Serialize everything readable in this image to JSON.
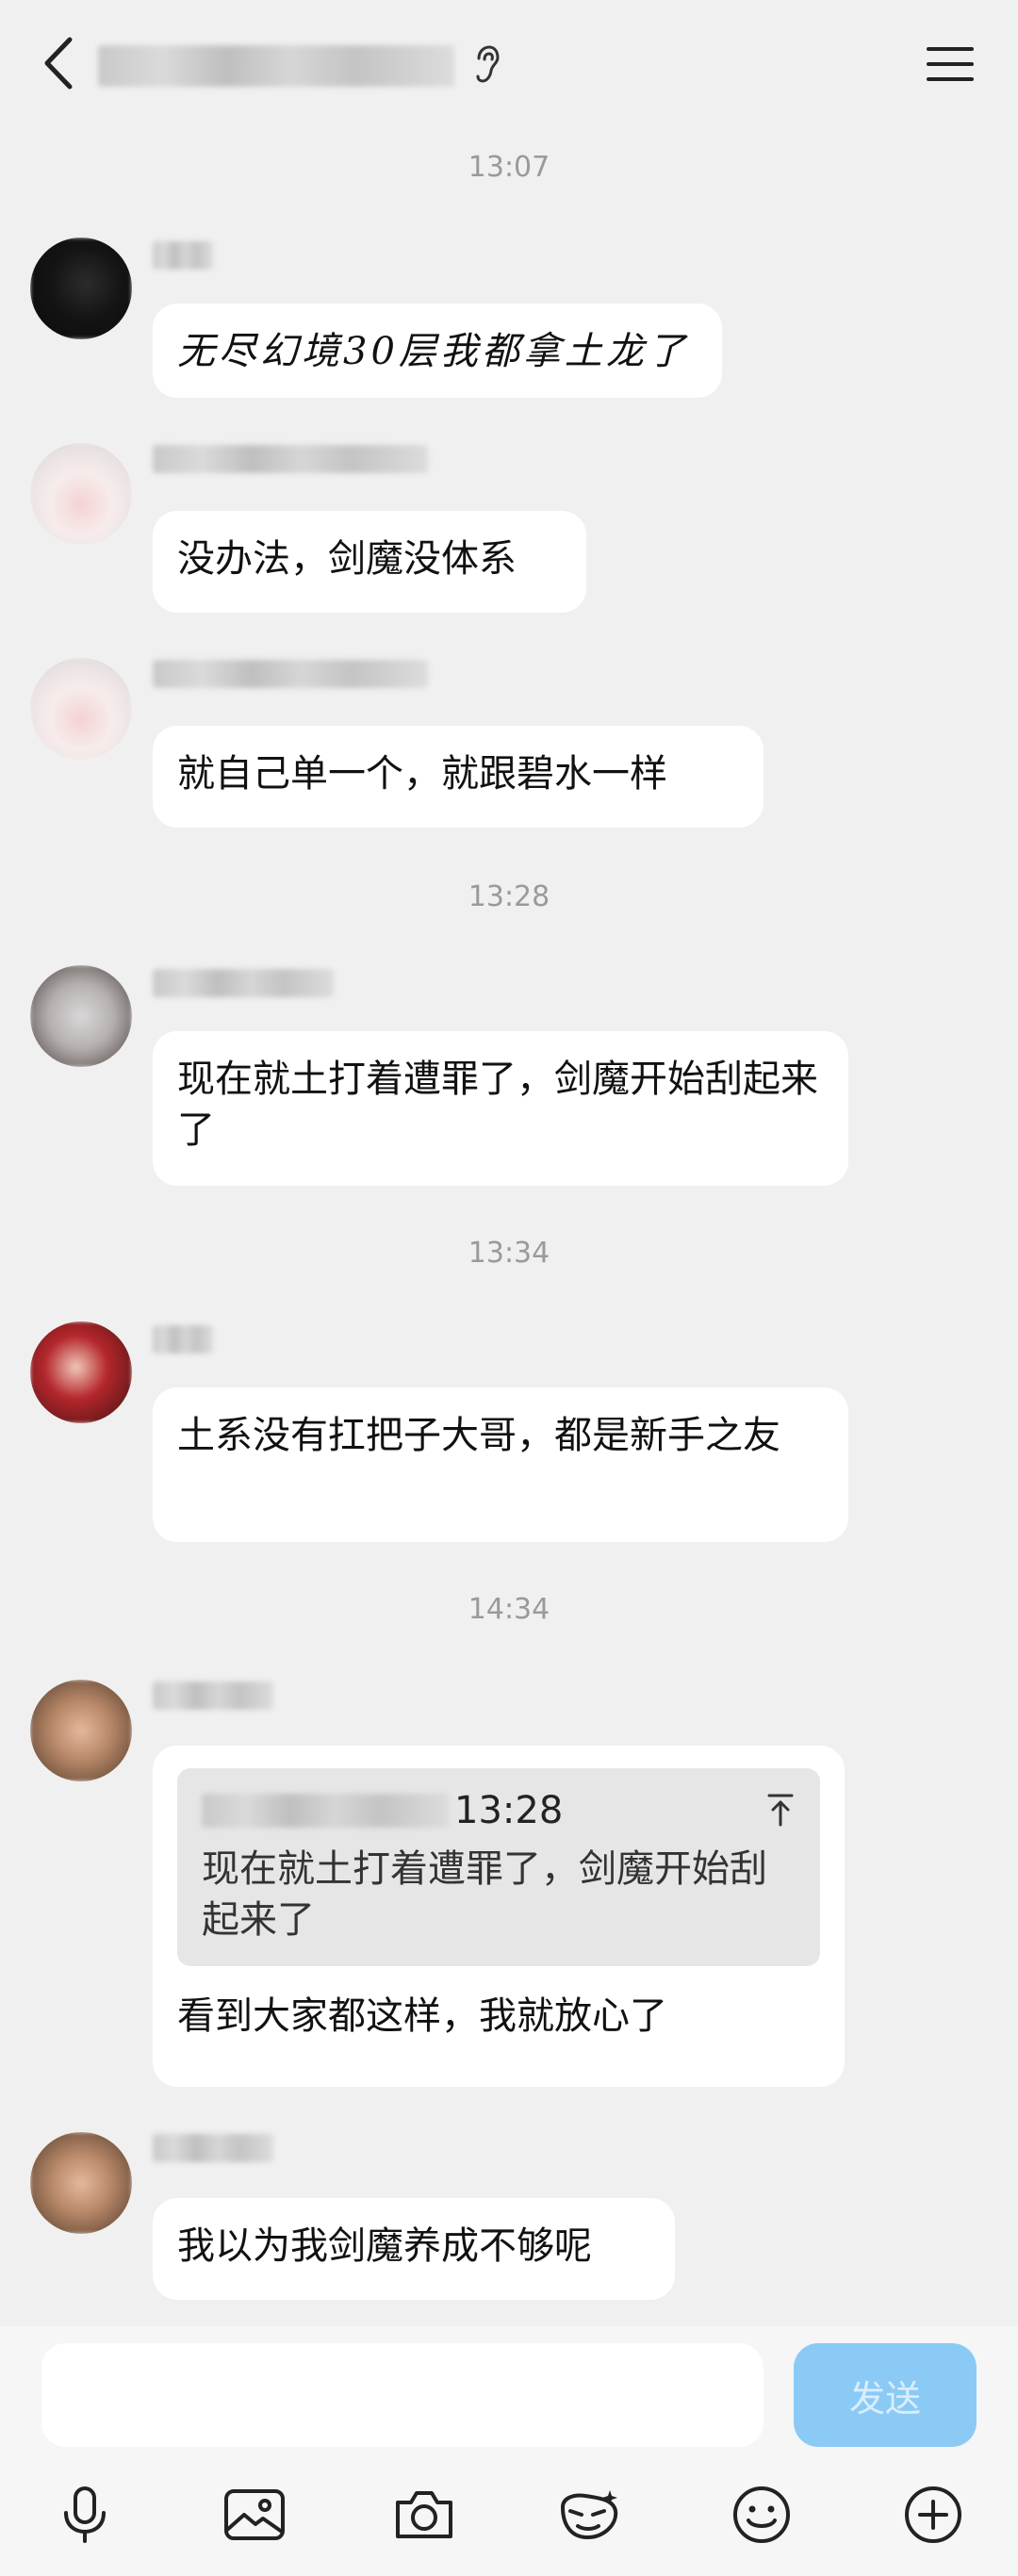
{
  "header": {
    "back_icon": "chevron-left-icon",
    "ear_icon": "ear-icon",
    "menu_icon": "menu-icon"
  },
  "timestamps": [
    "13:07",
    "13:28",
    "13:34",
    "14:34"
  ],
  "messages": [
    {
      "text": "无尽幻境30层我都拿土龙了"
    },
    {
      "text": "没办法，剑魔没体系"
    },
    {
      "text": "就自己单一个，就跟碧水一样"
    },
    {
      "text": "现在就土打着遭罪了，剑魔开始刮起来了"
    },
    {
      "text": "土系没有扛把子大哥，都是新手之友"
    },
    {
      "quote": {
        "time": "13:28",
        "text": "现在就土打着遭罪了，剑魔开始刮起来了"
      },
      "text": "看到大家都这样，我就放心了"
    },
    {
      "text": "我以为我剑魔养成不够呢"
    }
  ],
  "input": {
    "placeholder": "",
    "send_label": "发送"
  },
  "toolbar": [
    "microphone-icon",
    "image-icon",
    "camera-icon",
    "sticker-icon",
    "emoji-icon",
    "plus-icon"
  ],
  "colors": {
    "background": "#f0f0f0",
    "bubble": "#ffffff",
    "send_button": "#8ccaf6",
    "timestamp": "#9a9a9a"
  }
}
